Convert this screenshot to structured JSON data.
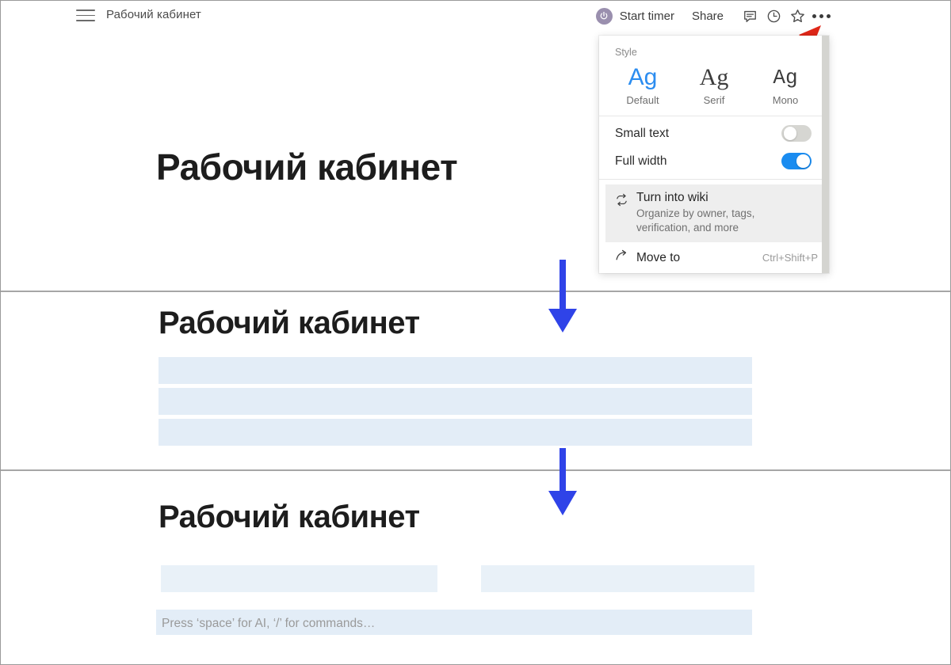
{
  "app": {
    "breadcrumb": "Рабочий кабинет",
    "accent_blue": "#1a8cf0",
    "arrow_red": "#e02718",
    "arrow_blue": "#2f43e8",
    "placeholder_blue": "#e3edf7"
  },
  "topbar": {
    "menu_icon": "hamburger-icon",
    "timer_label": "Start timer",
    "timer_icon": "power-icon",
    "share_label": "Share",
    "comment_icon": "comment-icon",
    "history_icon": "clock-icon",
    "favorite_icon": "star-icon",
    "more_icon": "more-dots-icon"
  },
  "dropdown": {
    "style_label": "Style",
    "style_options": [
      {
        "sample": "Ag",
        "name": "Default",
        "selected": true
      },
      {
        "sample": "Ag",
        "name": "Serif",
        "selected": false
      },
      {
        "sample": "Ag",
        "name": "Mono",
        "selected": false
      }
    ],
    "toggles": [
      {
        "label": "Small text",
        "state": "off"
      },
      {
        "label": "Full width",
        "state": "on"
      }
    ],
    "wiki": {
      "title": "Turn into wiki",
      "subtitle": "Organize by owner, tags, verification, and more",
      "icon": "convert-icon"
    },
    "move_to": {
      "label": "Move to",
      "shortcut": "Ctrl+Shift+P",
      "icon": "arrow-forward-icon"
    }
  },
  "panels": [
    {
      "id": "narrow-view",
      "title": "Рабочий кабинет",
      "blocks": []
    },
    {
      "id": "full-width-view",
      "title": "Рабочий кабинет",
      "blocks": [
        "",
        "",
        ""
      ]
    },
    {
      "id": "columns-view",
      "title": "Рабочий кабинет",
      "blocks": [
        "",
        ""
      ],
      "editor_placeholder": "Press ‘space’ for AI, ‘/’ for commands…"
    }
  ]
}
